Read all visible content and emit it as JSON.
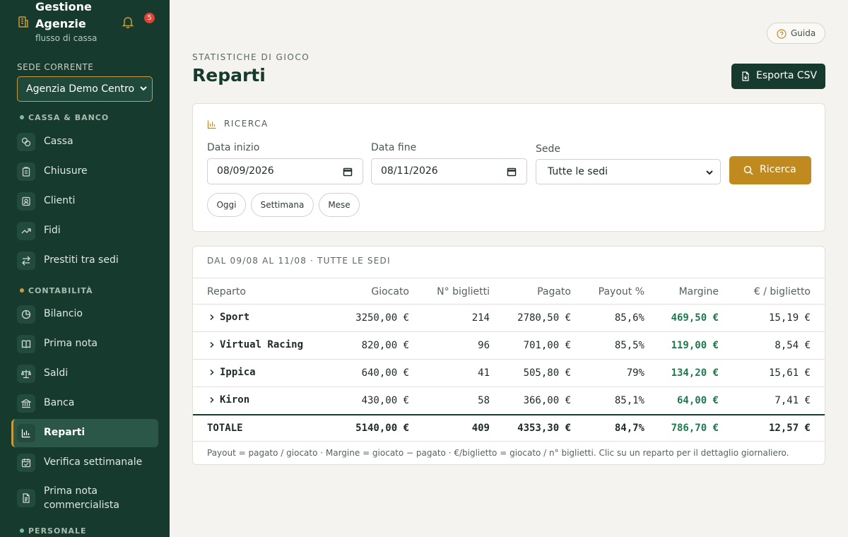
{
  "app": {
    "title": "Gestione Agenzie",
    "subtitle": "flusso di cassa",
    "notifications": "5"
  },
  "sede": {
    "label": "SEDE CORRENTE",
    "value": "Agenzia Demo Centro"
  },
  "sidebar": {
    "sections": [
      {
        "title": "CASSA & BANCO",
        "dot": "#7fb9a0"
      },
      {
        "title": "CONTABILITÀ",
        "dot": "#c89b3c"
      },
      {
        "title": "PERSONALE",
        "dot": "#7fb9a0"
      }
    ],
    "items": [
      {
        "label": "Cassa",
        "icon": "coins-icon"
      },
      {
        "label": "Chiusure",
        "icon": "clipboard-icon"
      },
      {
        "label": "Clienti",
        "icon": "contact-icon"
      },
      {
        "label": "Fidi",
        "icon": "trend-icon"
      },
      {
        "label": "Prestiti tra sedi",
        "icon": "arrows-exchange-icon"
      },
      {
        "label": "Bilancio",
        "icon": "pie-icon"
      },
      {
        "label": "Prima nota",
        "icon": "book-icon"
      },
      {
        "label": "Saldi",
        "icon": "scale-icon"
      },
      {
        "label": "Banca",
        "icon": "bank-icon"
      },
      {
        "label": "Reparti",
        "icon": "bar-chart-icon"
      },
      {
        "label": "Verifica settimanale",
        "icon": "calendar-check-icon"
      },
      {
        "label": "Prima nota commercialista",
        "icon": "document-icon"
      }
    ]
  },
  "header": {
    "guide_label": "Guida",
    "eyebrow": "STATISTICHE DI GIOCO",
    "title": "Reparti",
    "export_label": "Esporta CSV"
  },
  "search": {
    "heading": "RICERCA",
    "start_label": "Data inizio",
    "start_value": "08/09/2026",
    "end_label": "Data fine",
    "end_value": "08/11/2026",
    "sede_label": "Sede",
    "sede_value": "Tutte le sedi",
    "button": "Ricerca",
    "quick": [
      "Oggi",
      "Settimana",
      "Mese"
    ]
  },
  "report": {
    "range": "DAL 09/08 AL 11/08 · TUTTE LE SEDI",
    "columns": [
      "Reparto",
      "Giocato",
      "N° biglietti",
      "Pagato",
      "Payout %",
      "Margine",
      "€ / biglietto"
    ],
    "rows": [
      {
        "reparto": "Sport",
        "giocato": "3250,00 €",
        "biglietti": "214",
        "pagato": "2780,50 €",
        "payout": "85,6%",
        "margine": "469,50 €",
        "per": "15,19 €"
      },
      {
        "reparto": "Virtual Racing",
        "giocato": "820,00 €",
        "biglietti": "96",
        "pagato": "701,00 €",
        "payout": "85,5%",
        "margine": "119,00 €",
        "per": "8,54 €"
      },
      {
        "reparto": "Ippica",
        "giocato": "640,00 €",
        "biglietti": "41",
        "pagato": "505,80 €",
        "payout": "79%",
        "margine": "134,20 €",
        "per": "15,61 €"
      },
      {
        "reparto": "Kiron",
        "giocato": "430,00 €",
        "biglietti": "58",
        "pagato": "366,00 €",
        "payout": "85,1%",
        "margine": "64,00 €",
        "per": "7,41 €"
      }
    ],
    "total": {
      "reparto": "TOTALE",
      "giocato": "5140,00 €",
      "biglietti": "409",
      "pagato": "4353,30 €",
      "payout": "84,7%",
      "margine": "786,70 €",
      "per": "12,57 €"
    },
    "note": "Payout = pagato / giocato · Margine = giocato − pagato · €/biglietto = giocato / n° biglietti. Clic su un reparto per il dettaglio giornaliero."
  },
  "colors": {
    "sidebar": "#173a2f",
    "accent": "#c18a1f",
    "positive": "#1f7a4d"
  }
}
